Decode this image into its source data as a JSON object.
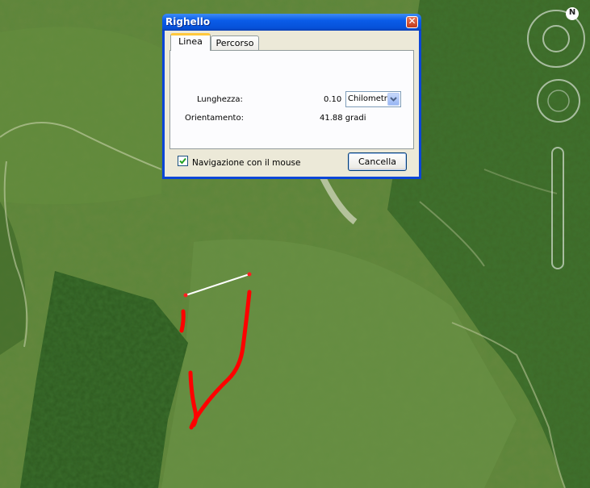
{
  "dialog": {
    "title": "Righello",
    "close_icon": "close-icon",
    "tabs": [
      {
        "label": "Linea",
        "selected": true
      },
      {
        "label": "Percorso",
        "selected": false
      }
    ],
    "length_label": "Lunghezza:",
    "length_value": "0.10",
    "unit": {
      "selected": "Chilometri"
    },
    "orientation_label": "Orientamento:",
    "orientation_value": "41.88 gradi",
    "mouse_nav": {
      "label": "Navigazione con il mouse",
      "checked": true
    },
    "cancel_label": "Cancella"
  },
  "nav": {
    "north_label": "N"
  },
  "colors": {
    "title_bar": "#0a5ce8",
    "dialog_face": "#ece9d8",
    "track_red": "#ff0000",
    "map_green": "#4f7a2f"
  }
}
